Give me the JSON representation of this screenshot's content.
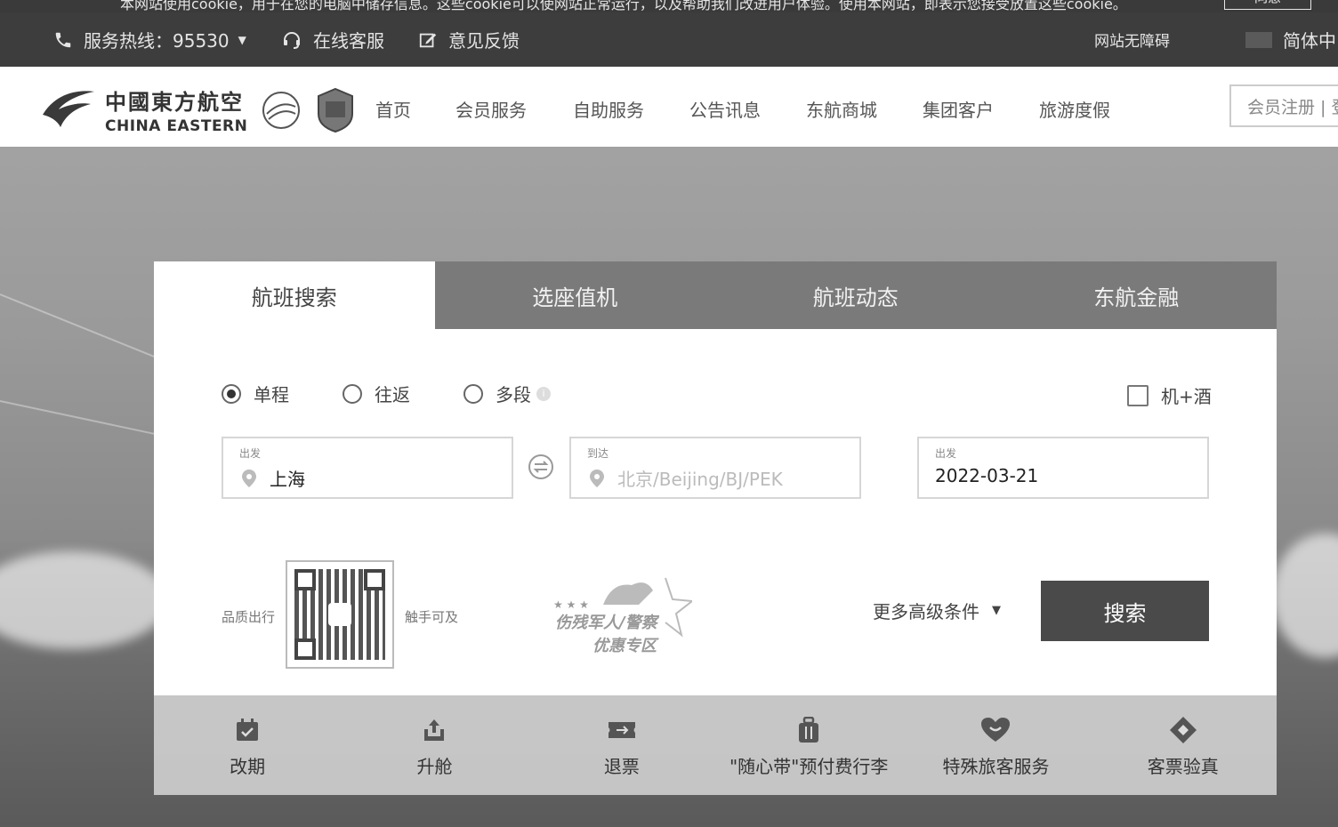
{
  "cookie": {
    "text": "本网站使用cookie，用于在您的电脑中储存信息。这些cookie可以使网站正常运行，以及帮助我们改进用户体验。使用本网站，即表示您接受放置这些cookie。",
    "button": "同意"
  },
  "topbar": {
    "hotline": "服务热线：95530",
    "online_service": "在线客服",
    "feedback": "意见反馈",
    "accessibility": "网站无障碍",
    "language": "简体中"
  },
  "brand": {
    "name_cn": "中國東方航空",
    "name_en": "CHINA EASTERN"
  },
  "nav": {
    "items": [
      "首页",
      "会员服务",
      "自助服务",
      "公告讯息",
      "东航商城",
      "集团客户",
      "旅游度假"
    ],
    "register": "会员注册 | 登"
  },
  "tabs": [
    "航班搜索",
    "选座值机",
    "航班动态",
    "东航金融"
  ],
  "search": {
    "trip_types": [
      "单程",
      "往返",
      "多段"
    ],
    "selected_trip": "单程",
    "hotel_combo": "机+酒",
    "from_label": "出发",
    "from_value": "上海",
    "to_label": "到达",
    "to_placeholder": "北京/Beijing/BJ/PEK",
    "date_label": "出发",
    "date_value": "2022-03-21",
    "qr_left": "品质出行",
    "qr_right": "触手可及",
    "promo_line1": "伤残军人/警察",
    "promo_line2": "优惠专区",
    "more_conditions": "更多高级条件",
    "search_button": "搜索"
  },
  "services": [
    {
      "label": "改期",
      "icon": "calendar-check-icon"
    },
    {
      "label": "升舱",
      "icon": "seat-upgrade-icon"
    },
    {
      "label": "退票",
      "icon": "ticket-refund-icon"
    },
    {
      "label": "\"随心带\"预付费行李",
      "icon": "luggage-icon"
    },
    {
      "label": "特殊旅客服务",
      "icon": "heart-hand-icon"
    },
    {
      "label": "客票验真",
      "icon": "ticket-verify-icon"
    }
  ]
}
